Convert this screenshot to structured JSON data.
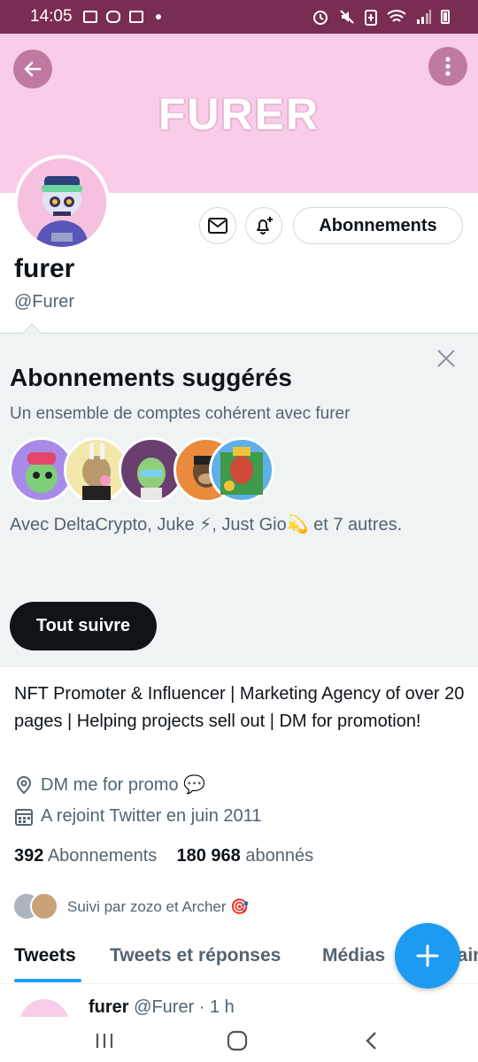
{
  "status_bar": {
    "time": "14:05"
  },
  "banner": {
    "title": "FURER",
    "bg": "#f9cde7"
  },
  "profile": {
    "name": "furer",
    "handle": "@Furer",
    "follow_label": "Abonnements"
  },
  "suggested": {
    "title": "Abonnements suggérés",
    "subtitle": "Un ensemble de comptes cohérent avec furer",
    "with_text": "Avec DeltaCrypto, Juke ⚡, Just Gio💫 et 7 autres.",
    "follow_all_label": "Tout suivre"
  },
  "bio": {
    "text": "NFT Promoter & Influencer | Marketing Agency of over 20 pages | Helping projects sell out | DM for promotion!",
    "location": "DM me for promo 💬",
    "joined": "A rejoint Twitter en juin 2011"
  },
  "stats": {
    "following_count": "392",
    "following_label": "Abonnements",
    "followers_count": "180 968",
    "followers_label": "abonnés"
  },
  "followed_by": "Suivi par zozo et Archer 🎯",
  "tabs": [
    {
      "label": "Tweets"
    },
    {
      "label": "Tweets et réponses"
    },
    {
      "label": "Médias"
    },
    {
      "label": "J'aime"
    }
  ],
  "tweet_peek": {
    "name": "furer",
    "meta": "@Furer · 1 h"
  },
  "colors": {
    "accent": "#1d9bf0",
    "status_bar": "#7a2d52"
  }
}
